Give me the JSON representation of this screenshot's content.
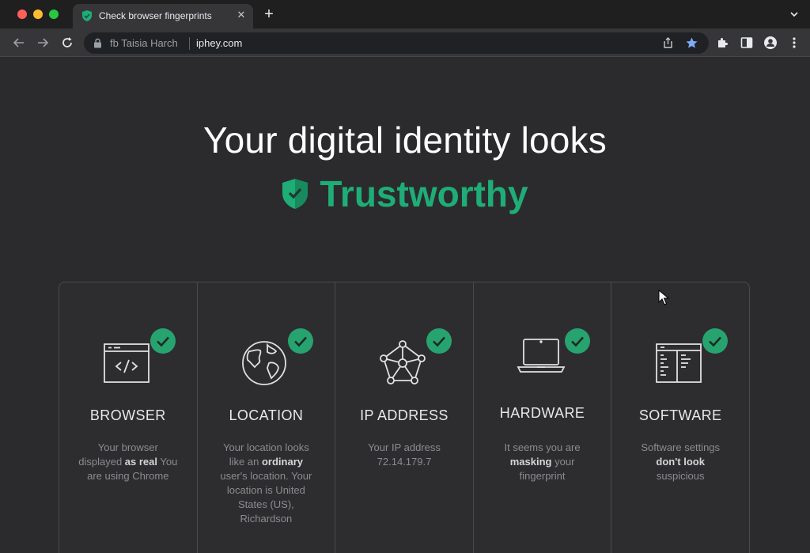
{
  "browser": {
    "tab": {
      "title": "Check browser fingerprints",
      "close": "✕"
    },
    "new_tab": "+",
    "address_bar": {
      "site_label": "fb Taisia Harch",
      "host": "iphey.com"
    }
  },
  "colors": {
    "accent": "#1fad77",
    "check": "#27a36f"
  },
  "hero": {
    "headline": "Your digital identity looks",
    "verdict": "Trustworthy"
  },
  "cards": [
    {
      "icon": "browser-code-icon",
      "title": "BROWSER",
      "desc": [
        "Your browser displayed ",
        "as real",
        " You are using Chrome"
      ]
    },
    {
      "icon": "globe-icon",
      "title": "LOCATION",
      "desc": [
        "Your location looks like an ",
        "ordinary",
        " user's location. Your location is United States (US), Richardson"
      ]
    },
    {
      "icon": "network-icon",
      "title": "IP ADDRESS",
      "desc": [
        "Your IP address 72.14.179.7",
        "",
        ""
      ]
    },
    {
      "icon": "laptop-icon",
      "title": "HARDWARE",
      "desc": [
        "It seems you are ",
        "masking",
        " your fingerprint"
      ]
    },
    {
      "icon": "software-window-icon",
      "title": "SOFTWARE",
      "desc": [
        "Software settings ",
        "don't look",
        " suspicious"
      ]
    }
  ]
}
